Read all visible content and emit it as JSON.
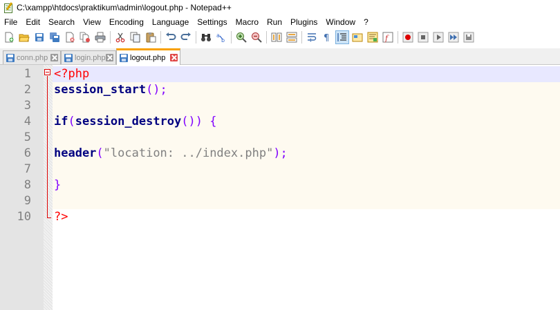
{
  "window": {
    "title": "C:\\xampp\\htdocs\\praktikum\\admin\\logout.php - Notepad++"
  },
  "menu": [
    "File",
    "Edit",
    "Search",
    "View",
    "Encoding",
    "Language",
    "Settings",
    "Macro",
    "Run",
    "Plugins",
    "Window",
    "?"
  ],
  "toolbar": {
    "buttons": [
      "new-file",
      "open-file",
      "save",
      "save-all",
      "close",
      "close-all",
      "print",
      "cut",
      "copy",
      "paste",
      "undo",
      "redo",
      "find",
      "replace",
      "zoom-in",
      "zoom-out",
      "sync-vertical",
      "sync-horizontal",
      "word-wrap",
      "show-all-characters",
      "indent-guide",
      "udl",
      "document-map",
      "function-list",
      "start-recording",
      "stop-recording",
      "playback",
      "run-macro-multiple",
      "save-macro"
    ],
    "active": "indent-guide"
  },
  "tabs": [
    {
      "label": "conn.php",
      "active": false
    },
    {
      "label": "login.php",
      "active": false
    },
    {
      "label": "logout.php",
      "active": true
    }
  ],
  "editor": {
    "current_line": 1,
    "lines": [
      {
        "num": "1",
        "tokens": [
          {
            "text": "<?php",
            "type": "php"
          }
        ]
      },
      {
        "num": "2",
        "tokens": [
          {
            "text": "session_start",
            "type": "fn"
          },
          {
            "text": "();",
            "type": "op"
          }
        ]
      },
      {
        "num": "3",
        "tokens": []
      },
      {
        "num": "4",
        "tokens": [
          {
            "text": "if",
            "type": "kw"
          },
          {
            "text": "(",
            "type": "op"
          },
          {
            "text": "session_destroy",
            "type": "fn"
          },
          {
            "text": "()) {",
            "type": "op"
          }
        ]
      },
      {
        "num": "5",
        "tokens": []
      },
      {
        "num": "6",
        "tokens": [
          {
            "text": "header",
            "type": "fn"
          },
          {
            "text": "(",
            "type": "op"
          },
          {
            "text": "\"location: ../index.php\"",
            "type": "str"
          },
          {
            "text": ");",
            "type": "op"
          }
        ]
      },
      {
        "num": "7",
        "tokens": []
      },
      {
        "num": "8",
        "tokens": [
          {
            "text": "}",
            "type": "op"
          }
        ]
      },
      {
        "num": "9",
        "tokens": []
      },
      {
        "num": "10",
        "tokens": [
          {
            "text": "?>",
            "type": "php"
          }
        ]
      }
    ]
  }
}
